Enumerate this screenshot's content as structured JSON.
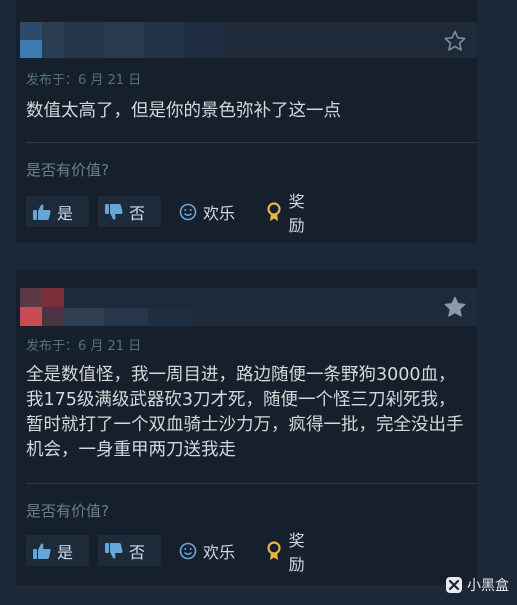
{
  "reviews": [
    {
      "posted": "发布于：6 月 21 日",
      "body": "数值太高了，但是你的景色弥补了这一点",
      "helpful_question": "是否有价值?",
      "buttons": {
        "yes": "是",
        "no": "否",
        "funny": "欢乐",
        "award": "奖励"
      },
      "avatar_colors": [
        "#3c7ab0",
        "#2e5f8a",
        "#4f6a82"
      ],
      "star_filled": false
    },
    {
      "posted": "发布于：6 月 21 日",
      "body": "全是数值怪，我一周目进，路边随便一条野狗3000血，我175级满级武器砍3刀才死，随便一个怪三刀剁死我，暂时就打了一个双血骑士沙力万，疯得一批，完全没出手机会，一身重甲两刀送我走",
      "helpful_question": "是否有价值?",
      "buttons": {
        "yes": "是",
        "no": "否",
        "funny": "欢乐",
        "award": "奖励"
      },
      "avatar_colors": [
        "#9a3440",
        "#c84c55",
        "#5b3a46"
      ],
      "star_filled": true
    }
  ],
  "watermark": {
    "text": "小黑盒"
  },
  "icons": {
    "star": "star-icon",
    "thumb_up": "thumbs-up-icon",
    "thumb_down": "thumbs-down-icon",
    "funny": "smiley-icon",
    "award": "award-icon"
  }
}
